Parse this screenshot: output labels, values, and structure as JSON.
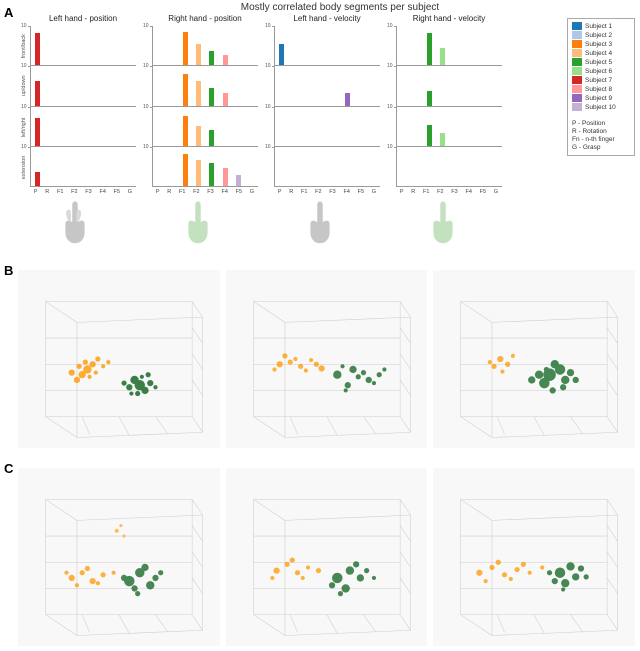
{
  "figure": {
    "title": "Mostly correlated body segments per subject",
    "section_a_label": "A",
    "section_b_label": "B",
    "section_c_label": "C"
  },
  "chart_columns": [
    {
      "title": "Left hand - position"
    },
    {
      "title": "Right hand - position"
    },
    {
      "title": "Left hand - velocity"
    },
    {
      "title": "Right hand - velocity"
    }
  ],
  "y_axis_labels": [
    "front/back",
    "up/down",
    "left/right",
    "extension"
  ],
  "x_axis_labels": [
    "P",
    "R",
    "F1",
    "F2",
    "F3",
    "F4",
    "F5",
    "G"
  ],
  "legend": {
    "subjects": [
      {
        "label": "Subject 1",
        "color": "#1f77b4"
      },
      {
        "label": "Subject 2",
        "color": "#aec7e8"
      },
      {
        "label": "Subject 3",
        "color": "#ff7f0e"
      },
      {
        "label": "Subject 4",
        "color": "#ffbb78"
      },
      {
        "label": "Subject 5",
        "color": "#2ca02c"
      },
      {
        "label": "Subject 6",
        "color": "#98df8a"
      },
      {
        "label": "Subject 7",
        "color": "#d62728"
      },
      {
        "label": "Subject 8",
        "color": "#ff9896"
      },
      {
        "label": "Subject 9",
        "color": "#9467bd"
      },
      {
        "label": "Subject 10",
        "color": "#c5b0d5"
      }
    ],
    "abbreviations": [
      "P - Position",
      "R - Rotation",
      "Fn - n-th finger",
      "G - Grasp"
    ]
  },
  "bars": {
    "left_hand_position": {
      "front_back": [
        {
          "x_idx": 0,
          "color": "#d62728",
          "height": 0.9
        }
      ],
      "up_down": [
        {
          "x_idx": 0,
          "color": "#d62728",
          "height": 0.7
        }
      ],
      "left_right": [
        {
          "x_idx": 0,
          "color": "#d62728",
          "height": 0.8
        }
      ],
      "extension": [
        {
          "x_idx": 0,
          "color": "#d62728",
          "height": 0.4
        }
      ]
    },
    "right_hand_position": {
      "front_back": [
        {
          "x_idx": 2,
          "color": "#ff7f0e",
          "height": 0.95
        },
        {
          "x_idx": 3,
          "color": "#ffbb78",
          "height": 0.6
        },
        {
          "x_idx": 4,
          "color": "#2ca02c",
          "height": 0.4
        },
        {
          "x_idx": 5,
          "color": "#ff9896",
          "height": 0.3
        }
      ],
      "up_down": [
        {
          "x_idx": 2,
          "color": "#ff7f0e",
          "height": 0.9
        },
        {
          "x_idx": 3,
          "color": "#ffbb78",
          "height": 0.7
        },
        {
          "x_idx": 4,
          "color": "#2ca02c",
          "height": 0.5
        },
        {
          "x_idx": 5,
          "color": "#ff9896",
          "height": 0.35
        }
      ],
      "left_right": [
        {
          "x_idx": 2,
          "color": "#ff7f0e",
          "height": 0.85
        },
        {
          "x_idx": 3,
          "color": "#ffbb78",
          "height": 0.55
        },
        {
          "x_idx": 4,
          "color": "#2ca02c",
          "height": 0.45
        }
      ],
      "extension": [
        {
          "x_idx": 2,
          "color": "#ff7f0e",
          "height": 0.9
        },
        {
          "x_idx": 3,
          "color": "#ffbb78",
          "height": 0.75
        },
        {
          "x_idx": 4,
          "color": "#2ca02c",
          "height": 0.65
        },
        {
          "x_idx": 5,
          "color": "#ff9896",
          "height": 0.5
        },
        {
          "x_idx": 6,
          "color": "#c5b0d5",
          "height": 0.3
        }
      ]
    },
    "left_hand_velocity": {
      "front_back": [
        {
          "x_idx": 0,
          "color": "#1f77b4",
          "height": 0.6
        }
      ],
      "up_down": [
        {
          "x_idx": 5,
          "color": "#9467bd",
          "height": 0.35
        }
      ],
      "left_right": [],
      "extension": []
    },
    "right_hand_velocity": {
      "front_back": [
        {
          "x_idx": 2,
          "color": "#2ca02c",
          "height": 0.9
        },
        {
          "x_idx": 3,
          "color": "#98df8a",
          "height": 0.5
        }
      ],
      "up_down": [
        {
          "x_idx": 2,
          "color": "#2ca02c",
          "height": 0.4
        }
      ],
      "left_right": [
        {
          "x_idx": 2,
          "color": "#2ca02c",
          "height": 0.6
        },
        {
          "x_idx": 3,
          "color": "#98df8a",
          "height": 0.35
        }
      ],
      "extension": []
    }
  }
}
